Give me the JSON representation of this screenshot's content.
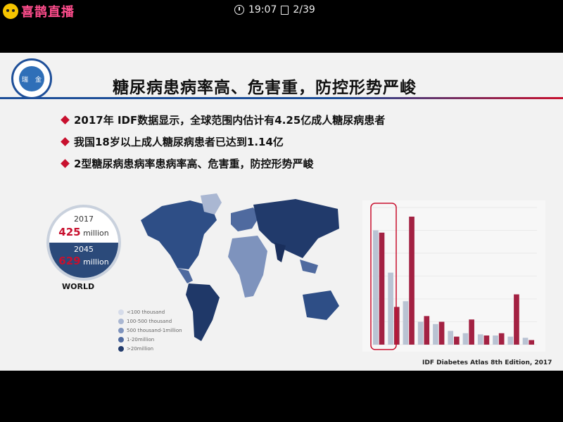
{
  "app": {
    "logo_text": "喜鹊直播",
    "time": "19:07",
    "page": "2/39"
  },
  "slide": {
    "title": "糖尿病患病率高、危害重，防控形势严峻",
    "emblem_left": "瑞",
    "emblem_right": "金",
    "bullets": [
      "2017年 IDF数据显示，全球范围内估计有4.25亿成人糖尿病患者",
      "我国18岁以上成人糖尿病患者已达到1.14亿",
      "2型糖尿病患病率患病率高、危害重，防控形势严峻"
    ],
    "world": {
      "year1": "2017",
      "val1": "425",
      "year2": "2045",
      "val2": "629",
      "unit": "million",
      "label": "WORLD"
    },
    "legend": [
      {
        "label": "<100 thousand",
        "color": "#d6dcea"
      },
      {
        "label": "100-500 thousand",
        "color": "#aab7d2"
      },
      {
        "label": "500 thousand-1million",
        "color": "#7e93bd"
      },
      {
        "label": "1-20million",
        "color": "#4f6a9f"
      },
      {
        "label": ">20million",
        "color": "#213a6b"
      }
    ],
    "source": "IDF Diabetes Atlas 8th Edition, 2017",
    "colors": {
      "accent_red": "#c8102e",
      "brand_blue": "#1e4f99",
      "map_dark": "#213a6b"
    }
  },
  "chart_data": {
    "type": "bar",
    "series": [
      {
        "values": [
          100,
          63,
          38,
          20,
          18,
          12,
          10,
          9,
          8,
          7,
          6
        ]
      },
      {
        "values": [
          98,
          33,
          112,
          25,
          20,
          7,
          22,
          8,
          10,
          44,
          4
        ]
      }
    ],
    "series_colors": [
      "#b9c3d3",
      "#a32142"
    ],
    "ylim": [
      0,
      120
    ]
  }
}
